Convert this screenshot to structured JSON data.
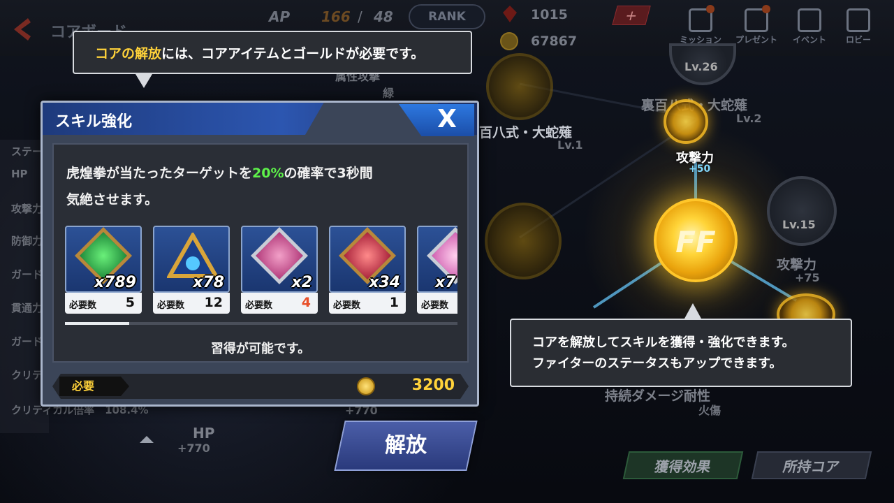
{
  "header": {
    "screen_title": "コアボード",
    "ap_label": "AP",
    "ap_current": "166",
    "ap_sep": "/",
    "ap_max": "48",
    "rank_label": "RANK",
    "ruby": "1015",
    "gold": "67867",
    "plus": "+",
    "nav": {
      "mission": "ミッション",
      "present": "プレゼント",
      "event": "イベント",
      "lobby": "ロビー"
    }
  },
  "board": {
    "top_label": "属性攻撃",
    "top_sub": "緑",
    "lv26": "Lv.26",
    "node_a_name": "裏百八式・大蛇薙",
    "node_a_lv": "Lv.2",
    "node_b_name": "百八式・大蛇薙",
    "node_b_lv": "Lv.1",
    "center_stat": "攻撃力",
    "center_val": "+50",
    "lv15": "Lv.15",
    "right_stat": "攻撃力",
    "right_val": "+75",
    "bottom_label": "持続ダメージ耐性",
    "bottom_sub": "火傷",
    "hp_label": "HP",
    "hp_val": "+770",
    "hp_val2": "+770"
  },
  "left_stats": {
    "heading": "ステー",
    "items": [
      "HP",
      "攻撃力",
      "防御力",
      "ガード",
      "貫通力",
      "ガード",
      "クリテ",
      "クリティカル倍率　108.4%"
    ]
  },
  "tip_top": {
    "highlight": "コアの解放",
    "rest": "には、コアアイテムとゴールドが必要です。"
  },
  "tip_right": {
    "line1": "コアを解放してスキルを獲得・強化できます。",
    "line2": "ファイターのステータスもアップできます。"
  },
  "dialog": {
    "title": "スキル強化",
    "close": "X",
    "desc_before": "虎煌拳が当たったターゲットを",
    "desc_pct": "20%",
    "desc_after": "の確率で3秒間",
    "desc_line2": "気絶させます。",
    "items": [
      {
        "count": "x789",
        "req_label": "必要数",
        "req": "5"
      },
      {
        "count": "x78",
        "req_label": "必要数",
        "req": "12"
      },
      {
        "count": "x2",
        "req_label": "必要数",
        "req": "4"
      },
      {
        "count": "x34",
        "req_label": "必要数",
        "req": "1"
      },
      {
        "count": "x7",
        "req_label": "必要数",
        "req": ""
      }
    ],
    "status": "習得が可能です。",
    "cost_label": "必要",
    "cost": "3200"
  },
  "buttons": {
    "release": "解放",
    "effect": "獲得効果",
    "owned_cores": "所持コア"
  },
  "colors": {
    "highlight_yellow": "#ffd23a",
    "percent_green": "#5ef24a",
    "required_red": "#e8502a",
    "dialog_blue": "#2c56b0"
  }
}
